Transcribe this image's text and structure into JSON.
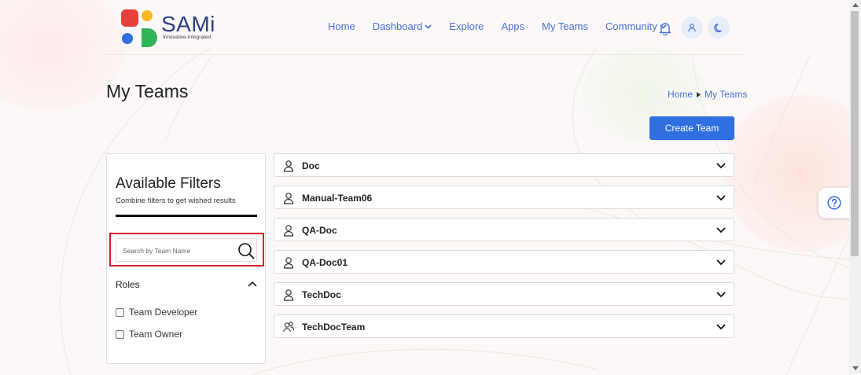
{
  "brand": {
    "name": "SAMi",
    "tagline": "Innovative-Integrated",
    "colors": {
      "red": "#e8413c",
      "yellow": "#f5b821",
      "blue": "#2f6fe0",
      "green": "#2fb457"
    }
  },
  "nav": {
    "items": [
      {
        "label": "Home",
        "dropdown": false
      },
      {
        "label": "Dashboard",
        "dropdown": true
      },
      {
        "label": "Explore",
        "dropdown": false
      },
      {
        "label": "Apps",
        "dropdown": false
      },
      {
        "label": "My Teams",
        "dropdown": false
      },
      {
        "label": "Community",
        "dropdown": true
      }
    ],
    "icons": [
      "bell-icon",
      "user-icon",
      "moon-icon"
    ],
    "accent": "#4a6fd8"
  },
  "page": {
    "title": "My Teams",
    "breadcrumb": [
      "Home",
      "My Teams"
    ],
    "create_button": "Create Team"
  },
  "filters": {
    "title": "Available Filters",
    "subtitle": "Combine filters to get wished results",
    "search_placeholder": "Search by Team Name",
    "search_value": "",
    "roles": {
      "label": "Roles",
      "expanded": true,
      "options": [
        {
          "label": "Team Developer",
          "checked": false
        },
        {
          "label": "Team Owner",
          "checked": false
        }
      ]
    }
  },
  "teams": [
    {
      "name": "Doc",
      "icon": "user-icon"
    },
    {
      "name": "Manual-Team06",
      "icon": "user-icon"
    },
    {
      "name": "QA-Doc",
      "icon": "user-icon"
    },
    {
      "name": "QA-Doc01",
      "icon": "user-icon"
    },
    {
      "name": "TechDoc",
      "icon": "user-icon"
    },
    {
      "name": "TechDocTeam",
      "icon": "users-icon"
    }
  ]
}
